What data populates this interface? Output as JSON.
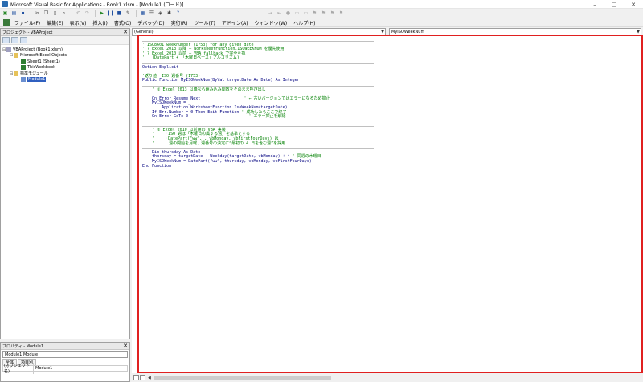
{
  "window": {
    "title": "Microsoft Visual Basic for Applications - Book1.xlsm - [Module1 (コード)]",
    "min": "–",
    "max": "□",
    "close": "✕"
  },
  "menu": [
    "ファイル(F)",
    "編集(E)",
    "表示(V)",
    "挿入(I)",
    "書式(O)",
    "デバッグ(D)",
    "実行(R)",
    "ツール(T)",
    "アドイン(A)",
    "ウィンドウ(W)",
    "ヘルプ(H)"
  ],
  "project": {
    "header": "プロジェクト - VBAProject",
    "tree": [
      {
        "label": "VBAProject (Book1.xlsm)",
        "icon": "project-icon",
        "indent": 0,
        "toggle": "⊟"
      },
      {
        "label": "Microsoft Excel Objects",
        "icon": "folder-icon",
        "indent": 1,
        "toggle": "⊟"
      },
      {
        "label": "Sheet1 (Sheet1)",
        "icon": "sheet-icon",
        "indent": 2,
        "toggle": ""
      },
      {
        "label": "ThisWorkbook",
        "icon": "sheet-icon",
        "indent": 2,
        "toggle": ""
      },
      {
        "label": "標準モジュール",
        "icon": "folder-icon",
        "indent": 1,
        "toggle": "⊟"
      },
      {
        "label": "Module1",
        "icon": "module-icon",
        "indent": 2,
        "toggle": "",
        "selected": true
      }
    ]
  },
  "properties": {
    "header": "プロパティ - Module1",
    "object": "Module1 Module",
    "tabs": [
      "全体",
      "項目別"
    ],
    "row_key": "(オブジェクト名)",
    "row_value": "Module1"
  },
  "code_window": {
    "object_combo": "(General)",
    "proc_combo": "MyISOWeekNum",
    "lines": [
      {
        "t": "sep"
      },
      {
        "t": "cm",
        "s": "' ISO8601 weeknumber (1753) for any given date"
      },
      {
        "t": "cm",
        "s": "' ? Excel 2013 以降 ― WorksheetFunction.ISOWEEKNUM を優先使用"
      },
      {
        "t": "cm",
        "s": "' ? Excel 2010 以前 ― VBA fallback で完全互換"
      },
      {
        "t": "cm",
        "s": "'   (DatePart + 「木曜日ベース」アルゴリズム)"
      },
      {
        "t": "sep"
      },
      {
        "t": "kw",
        "s": "Option Explicit"
      },
      {
        "t": "blank"
      },
      {
        "t": "cm",
        "s": "'返り値: ISO 週番号 (1753)"
      },
      {
        "t": "kw",
        "s": "Public Function MyISOWeekNum(ByVal targetDate As Date) As Integer"
      },
      {
        "t": "sep"
      },
      {
        "t": "cm",
        "s": "    ' ① Excel 2013 以降なら組み込み関数をそのまま呼び出し"
      },
      {
        "t": "sep"
      },
      {
        "t": "mix",
        "a": "    On Error Resume Next                  ",
        "b": "' ← 古いバージョンではエラーになるため抑止"
      },
      {
        "t": "kw",
        "s": "    MyISOWeekNum = _"
      },
      {
        "t": "kw",
        "s": "        Application.WorksheetFunction.IsoWeekNum(targetDate)"
      },
      {
        "t": "mix",
        "a": "    If Err.Number = 0 Then Exit Function ",
        "b": "' 成功したらここで終了"
      },
      {
        "t": "mix",
        "a": "    On Error GoTo 0                         ",
        "b": "' エラー抑止を解除"
      },
      {
        "t": "blank"
      },
      {
        "t": "sep"
      },
      {
        "t": "cm",
        "s": "    ' ② Excel 2010 以前用の VBA 実装"
      },
      {
        "t": "cm",
        "s": "    '    ・ISO 週は「木曜日の属する週」を基準とする"
      },
      {
        "t": "cm",
        "s": "    '    ・DatePart(\"ww\", , vbMonday, vbFirstFourDays) は"
      },
      {
        "t": "cm",
        "s": "    '      週の開始を月曜、週番号の決定に“最初の 4 日を含む週”を採用"
      },
      {
        "t": "sep"
      },
      {
        "t": "kw",
        "s": "    Dim thursday As Date"
      },
      {
        "t": "mix",
        "a": "    thursday = targetDate - Weekday(targetDate, vbMonday) + 4 ",
        "b": "' 同週の木曜日"
      },
      {
        "t": "kw",
        "s": "    MyISOWeekNum = DatePart(\"ww\", thursday, vbMonday, vbFirstFourDays)"
      },
      {
        "t": "kw",
        "s": "End Function"
      }
    ]
  }
}
